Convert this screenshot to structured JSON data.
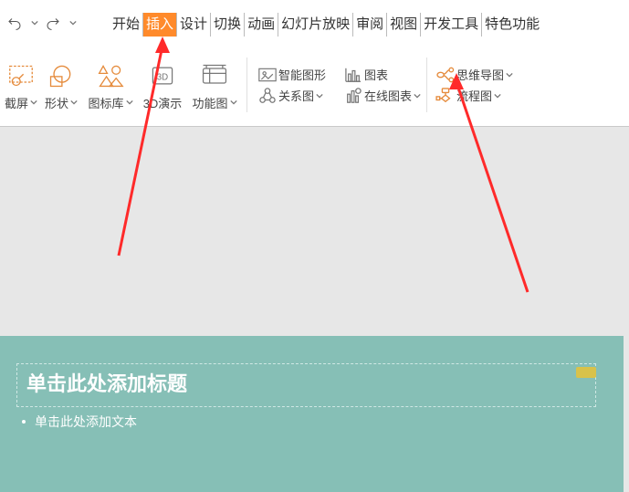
{
  "qat": {
    "undo": "撤销",
    "redo": "重做"
  },
  "tabs": [
    "开始",
    "插入",
    "设计",
    "切换",
    "动画",
    "幻灯片放映",
    "审阅",
    "视图",
    "开发工具",
    "特色功能"
  ],
  "activeTabIndex": 1,
  "ribbon": {
    "crop": "截屏",
    "shape": "形状",
    "iconlib": "图标库",
    "threeD": "3D演示",
    "func": "功能图",
    "smart": "智能图形",
    "chart": "图表",
    "relation": "关系图",
    "onlineChart": "在线图表",
    "mind": "思维导图",
    "flow": "流程图"
  },
  "slide": {
    "title": "单击此处添加标题",
    "body": "单击此处添加文本"
  }
}
